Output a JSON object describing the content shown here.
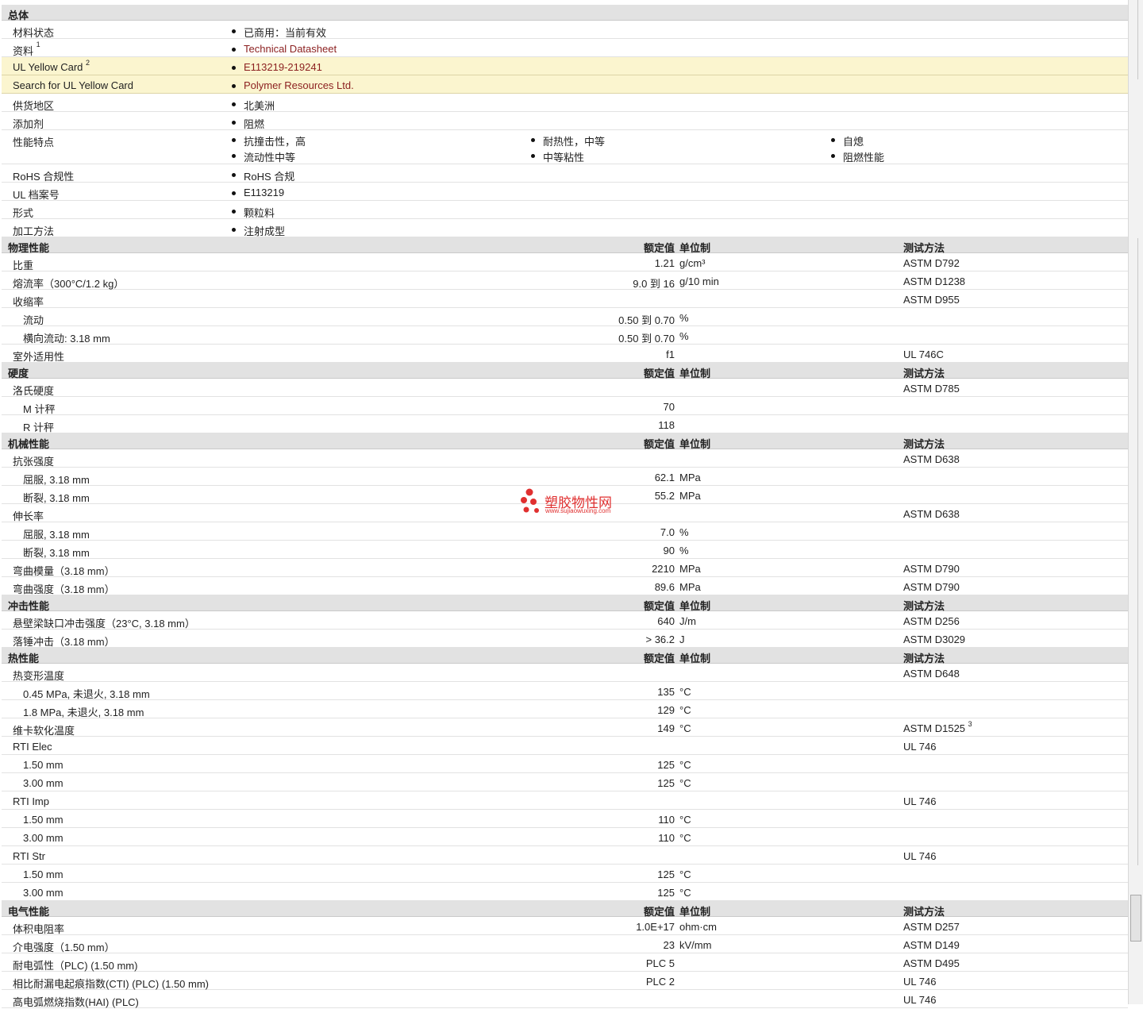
{
  "general": {
    "title": "总体",
    "rows": [
      {
        "label": "材料状态",
        "items": [
          "已商用：当前有效"
        ]
      },
      {
        "label": "资料",
        "sup": "1",
        "items": [
          "Technical Datasheet"
        ],
        "link": true
      },
      {
        "label": "UL Yellow Card",
        "sup": "2",
        "items": [
          "E113219-219241"
        ],
        "link": true,
        "highlight": true
      },
      {
        "label": "Search for UL Yellow Card",
        "items": [
          "Polymer Resources Ltd."
        ],
        "link": true,
        "highlight": true
      },
      {
        "label": "供货地区",
        "items": [
          "北美洲"
        ]
      },
      {
        "label": "添加剂",
        "items": [
          "阻燃"
        ]
      },
      {
        "label": "性能特点",
        "columns": [
          [
            "抗撞击性，高",
            "流动性中等"
          ],
          [
            "耐热性，中等",
            "中等粘性"
          ],
          [
            "自熄",
            "阻燃性能"
          ]
        ]
      },
      {
        "label": "RoHS 合规性",
        "items": [
          "RoHS 合规"
        ]
      },
      {
        "label": "UL 档案号",
        "items": [
          "E113219"
        ]
      },
      {
        "label": "形式",
        "items": [
          "颗粒料"
        ]
      },
      {
        "label": "加工方法",
        "items": [
          "注射成型"
        ]
      }
    ]
  },
  "columns": {
    "nominal": "额定值",
    "unit": "单位制",
    "test": "测试方法"
  },
  "sections": [
    {
      "title": "物理性能",
      "rows": [
        {
          "label": "比重",
          "value": "1.21",
          "unit": "g/cm³",
          "test": "ASTM D792"
        },
        {
          "label": "熔流率（300°C/1.2 kg）",
          "value": "9.0 到  16",
          "unit": "g/10 min",
          "test": "ASTM D1238"
        },
        {
          "label": "收缩率",
          "value": "",
          "unit": "",
          "test": "ASTM D955"
        },
        {
          "label": "流动",
          "indent": true,
          "value": "0.50 到  0.70",
          "unit": "%",
          "test": ""
        },
        {
          "label": "横向流动: 3.18 mm",
          "indent": true,
          "value": "0.50 到  0.70",
          "unit": "%",
          "test": ""
        },
        {
          "label": "室外适用性",
          "value": "f1",
          "unit": "",
          "test": "UL 746C"
        }
      ]
    },
    {
      "title": "硬度",
      "rows": [
        {
          "label": "洛氏硬度",
          "value": "",
          "unit": "",
          "test": "ASTM D785"
        },
        {
          "label": "M 计秤",
          "indent": true,
          "value": "70",
          "unit": "",
          "test": ""
        },
        {
          "label": "R 计秤",
          "indent": true,
          "value": "118",
          "unit": "",
          "test": ""
        }
      ]
    },
    {
      "title": "机械性能",
      "rows": [
        {
          "label": "抗张强度",
          "value": "",
          "unit": "",
          "test": "ASTM D638"
        },
        {
          "label": "屈服, 3.18 mm",
          "indent": true,
          "value": "62.1",
          "unit": "MPa",
          "test": ""
        },
        {
          "label": "断裂, 3.18 mm",
          "indent": true,
          "value": "55.2",
          "unit": "MPa",
          "test": ""
        },
        {
          "label": "伸长率",
          "value": "",
          "unit": "",
          "test": "ASTM D638"
        },
        {
          "label": "屈服, 3.18 mm",
          "indent": true,
          "value": "7.0",
          "unit": "%",
          "test": ""
        },
        {
          "label": "断裂, 3.18 mm",
          "indent": true,
          "value": "90",
          "unit": "%",
          "test": ""
        },
        {
          "label": "弯曲模量（3.18 mm）",
          "value": "2210",
          "unit": "MPa",
          "test": "ASTM D790"
        },
        {
          "label": "弯曲强度（3.18 mm）",
          "value": "89.6",
          "unit": "MPa",
          "test": "ASTM D790"
        }
      ]
    },
    {
      "title": "冲击性能",
      "rows": [
        {
          "label": "悬壁梁缺口冲击强度（23°C, 3.18 mm）",
          "value": "640",
          "unit": "J/m",
          "test": "ASTM D256"
        },
        {
          "label": "落锤冲击（3.18 mm）",
          "value": "> 36.2",
          "unit": "J",
          "test": "ASTM D3029"
        }
      ]
    },
    {
      "title": "热性能",
      "rows": [
        {
          "label": "热变形温度",
          "value": "",
          "unit": "",
          "test": "ASTM D648"
        },
        {
          "label": "0.45 MPa, 未退火, 3.18 mm",
          "indent": true,
          "value": "135",
          "unit": "°C",
          "test": ""
        },
        {
          "label": "1.8 MPa, 未退火, 3.18 mm",
          "indent": true,
          "value": "129",
          "unit": "°C",
          "test": ""
        },
        {
          "label": "维卡软化温度",
          "value": "149",
          "unit": "°C",
          "test": "ASTM D1525",
          "test_sup": "3"
        },
        {
          "label": "RTI Elec",
          "value": "",
          "unit": "",
          "test": "UL 746"
        },
        {
          "label": "1.50 mm",
          "indent": true,
          "value": "125",
          "unit": "°C",
          "test": ""
        },
        {
          "label": "3.00 mm",
          "indent": true,
          "value": "125",
          "unit": "°C",
          "test": ""
        },
        {
          "label": "RTI Imp",
          "value": "",
          "unit": "",
          "test": "UL 746"
        },
        {
          "label": "1.50 mm",
          "indent": true,
          "value": "110",
          "unit": "°C",
          "test": ""
        },
        {
          "label": "3.00 mm",
          "indent": true,
          "value": "110",
          "unit": "°C",
          "test": ""
        },
        {
          "label": "RTI Str",
          "value": "",
          "unit": "",
          "test": "UL 746"
        },
        {
          "label": "1.50 mm",
          "indent": true,
          "value": "125",
          "unit": "°C",
          "test": ""
        },
        {
          "label": "3.00 mm",
          "indent": true,
          "value": "125",
          "unit": "°C",
          "test": ""
        }
      ]
    },
    {
      "title": "电气性能",
      "rows": [
        {
          "label": "体积电阻率",
          "value": "1.0E+17",
          "unit": "ohm·cm",
          "test": "ASTM D257"
        },
        {
          "label": "介电强度（1.50 mm）",
          "value": "23",
          "unit": "kV/mm",
          "test": "ASTM D149"
        },
        {
          "label": "耐电弧性（PLC) (1.50 mm)",
          "value": "PLC 5",
          "unit": "",
          "test": "ASTM D495"
        },
        {
          "label": "相比耐漏电起痕指数(CTI) (PLC) (1.50 mm)",
          "value": "PLC 2",
          "unit": "",
          "test": "UL 746"
        },
        {
          "label": "高电弧燃烧指数(HAI) (PLC)",
          "value": "",
          "unit": "",
          "test": "UL 746"
        }
      ]
    }
  ],
  "watermark": {
    "title": "塑胶物性网",
    "url": "www.sujiaowuxing.com"
  },
  "colors": {
    "link": "#8b1f1f",
    "highlight": "#fbf5cf",
    "section_bg": "#e2e2e2",
    "watermark": "#e03030"
  }
}
